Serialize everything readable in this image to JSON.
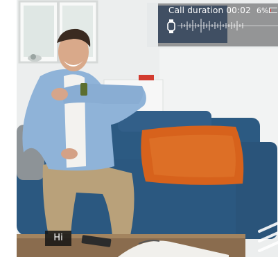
{
  "hud": {
    "call_label": "Call duration",
    "call_time": "00:02",
    "battery_percent": "6%",
    "battery_level": 0.06,
    "battery_color": "#e23b3b",
    "watch_icon": "smartwatch-icon"
  },
  "caption": {
    "text": "Hi"
  },
  "colors": {
    "sofa": "#2f5d86",
    "pillow": "#d8641f",
    "wall": "#eef0f0"
  }
}
